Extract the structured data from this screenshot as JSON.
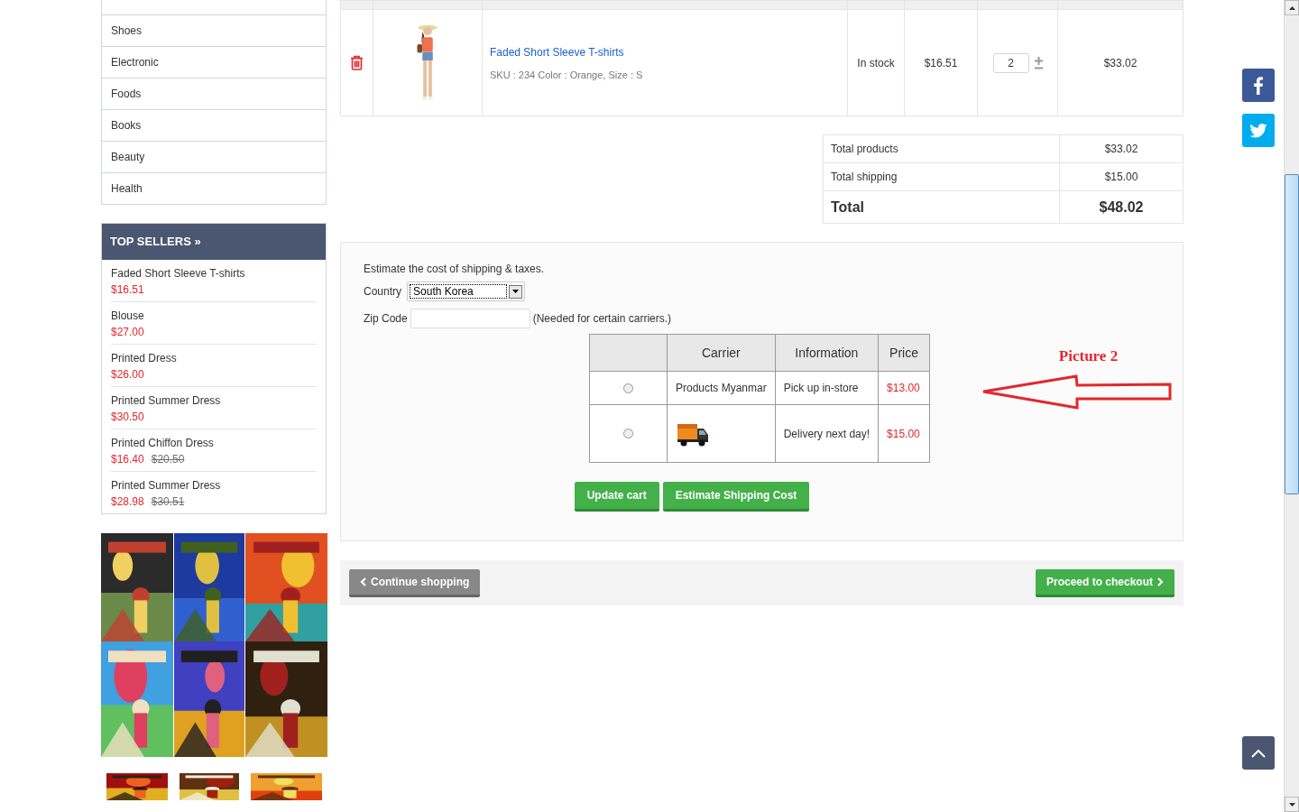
{
  "sidebar": {
    "categories": [
      "Shoes",
      "Electronic",
      "Foods",
      "Books",
      "Beauty",
      "Health"
    ],
    "top_sellers": {
      "title": "TOP SELLERS »",
      "items": [
        {
          "name": "Faded Short Sleeve T-shirts",
          "price": "$16.51"
        },
        {
          "name": "Blouse",
          "price": "$27.00"
        },
        {
          "name": "Printed Dress",
          "price": "$26.00"
        },
        {
          "name": "Printed Summer Dress",
          "price": "$30.50"
        },
        {
          "name": "Printed Chiffon Dress",
          "price": "$16.40",
          "old_price": "$20.50"
        },
        {
          "name": "Printed Summer Dress",
          "price": "$28.98",
          "old_price": "$30.51"
        }
      ]
    }
  },
  "cart": {
    "items": [
      {
        "name": "Faded Short Sleeve T-shirts",
        "details": "SKU : 234 Color : Orange, Size : S",
        "availability": "In stock",
        "unit_price": "$16.51",
        "quantity": "2",
        "total": "$33.02"
      }
    ]
  },
  "totals": [
    {
      "kind": "line",
      "label": "Total products",
      "value": "$33.02"
    },
    {
      "kind": "line",
      "label": "Total shipping",
      "value": "$15.00"
    },
    {
      "kind": "grand",
      "label": "Total",
      "value": "$48.02"
    }
  ],
  "shipping": {
    "intro": "Estimate the cost of shipping & taxes.",
    "country_label": "Country",
    "country_value": "South Korea",
    "zip_label": "Zip Code",
    "zip_note": "(Needed for certain carriers.)",
    "carrier_table": {
      "columns": [
        "Carrier",
        "Information",
        "Price"
      ],
      "rows": [
        {
          "selected": false,
          "kind": "text",
          "carrier": "Products Myanmar",
          "information": "Pick up in-store",
          "price": "$13.00"
        },
        {
          "selected": false,
          "kind": "logo",
          "information": "Delivery next day!",
          "price": "$15.00"
        }
      ]
    },
    "buttons": [
      "Update cart",
      "Estimate Shipping Cost"
    ]
  },
  "annotation": {
    "label": "Picture 2"
  },
  "navigation": {
    "back": "Continue shopping",
    "forward": "Proceed to checkout"
  }
}
